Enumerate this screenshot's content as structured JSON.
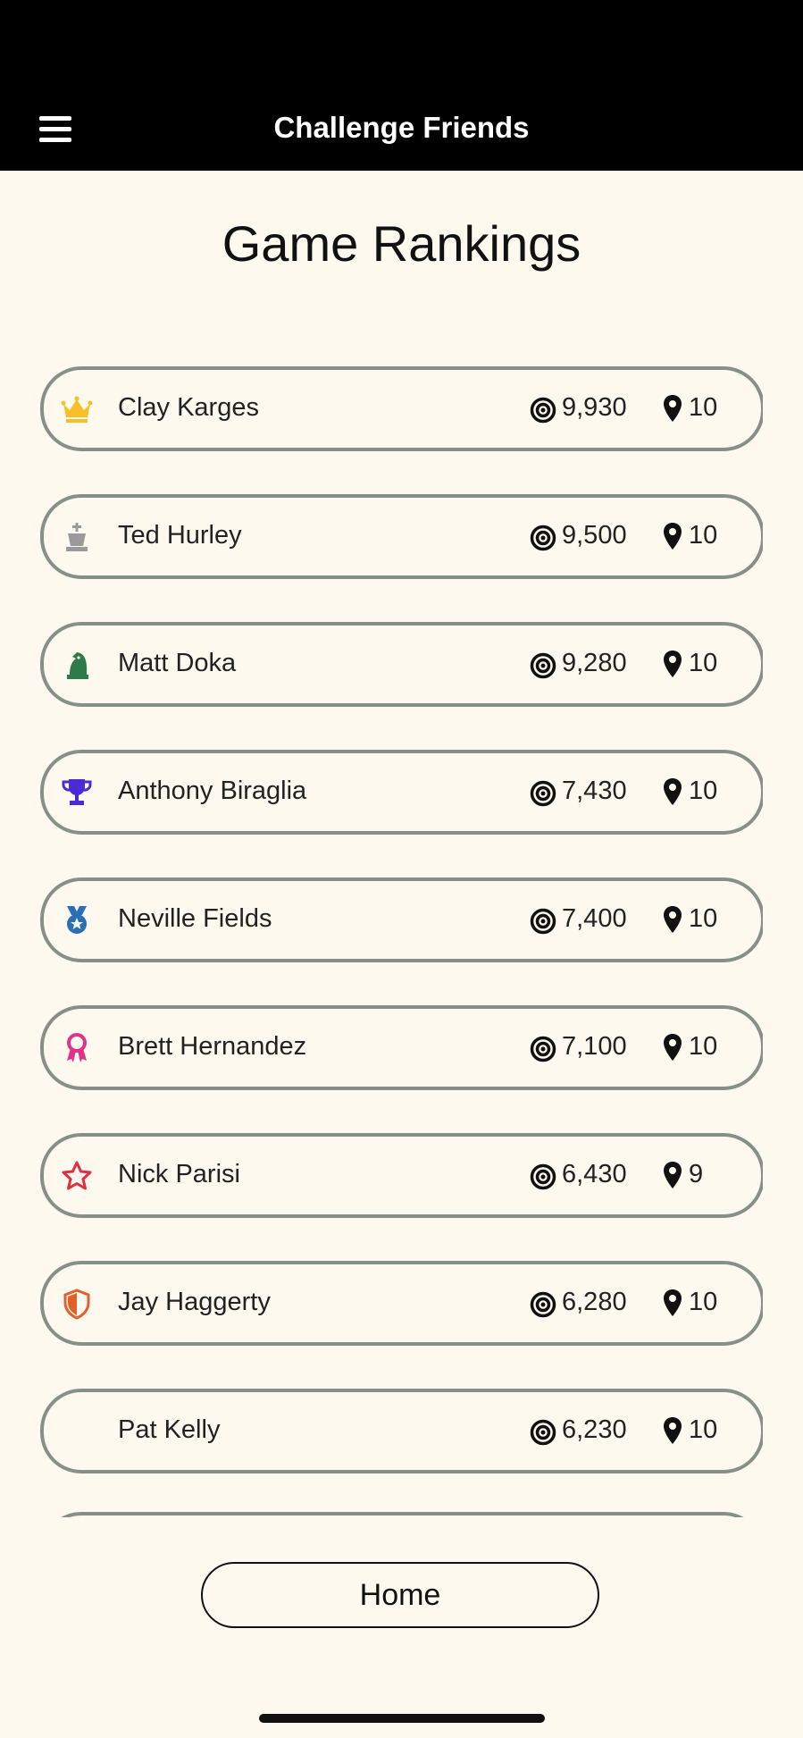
{
  "header": {
    "title": "Challenge Friends"
  },
  "page": {
    "title": "Game Rankings"
  },
  "rankings": [
    {
      "icon": "crown-icon",
      "color": "#f6c026",
      "name": "Clay Karges",
      "score": "9,930",
      "locations": "10"
    },
    {
      "icon": "chess-king-icon",
      "color": "#9a9a9a",
      "name": "Ted Hurley",
      "score": "9,500",
      "locations": "10"
    },
    {
      "icon": "chess-knight-icon",
      "color": "#2f7a4a",
      "name": "Matt Doka",
      "score": "9,280",
      "locations": "10"
    },
    {
      "icon": "trophy-icon",
      "color": "#4b2bd6",
      "name": "Anthony Biraglia",
      "score": "7,430",
      "locations": "10"
    },
    {
      "icon": "medal-icon",
      "color": "#2a6fb6",
      "name": "Neville Fields",
      "score": "7,400",
      "locations": "10"
    },
    {
      "icon": "ribbon-award-icon",
      "color": "#e0338a",
      "name": "Brett Hernandez",
      "score": "7,100",
      "locations": "10"
    },
    {
      "icon": "star-outline-icon",
      "color": "#e02e44",
      "name": "Nick Parisi",
      "score": "6,430",
      "locations": "9"
    },
    {
      "icon": "shield-icon",
      "color": "#e0622a",
      "name": "Jay Haggerty",
      "score": "6,280",
      "locations": "10"
    },
    {
      "icon": "",
      "color": "",
      "name": "Pat Kelly",
      "score": "6,230",
      "locations": "10"
    }
  ],
  "footer": {
    "home_label": "Home"
  }
}
